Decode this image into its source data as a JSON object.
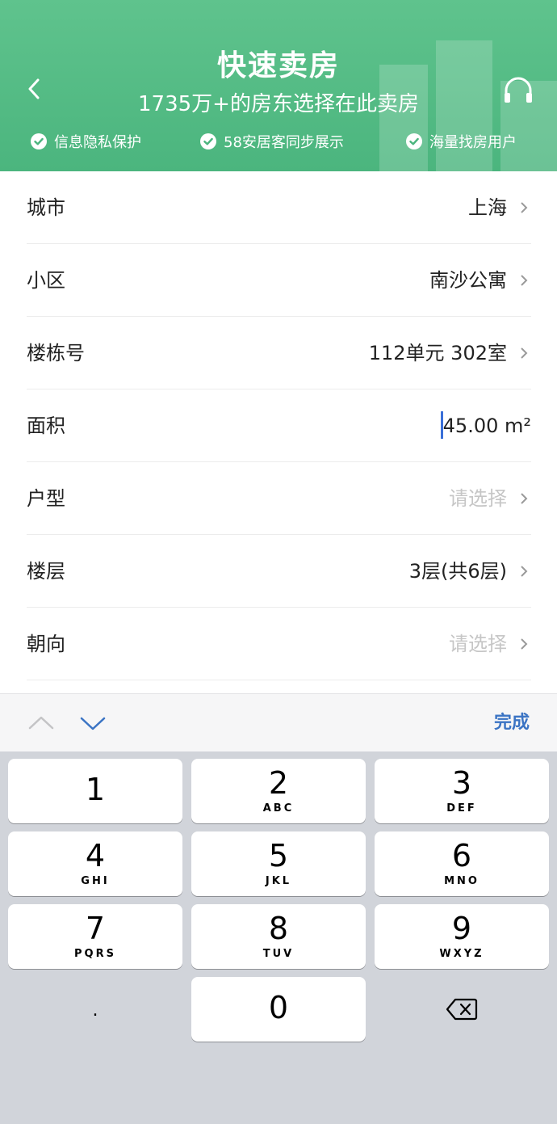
{
  "header": {
    "back_icon": "chevron-left-icon",
    "title": "快速卖房",
    "subtitle": "1735万+的房东选择在此卖房",
    "service_icon": "headset-icon",
    "features": [
      {
        "icon": "check-circle-icon",
        "label": "信息隐私保护"
      },
      {
        "icon": "check-circle-icon",
        "label": "58安居客同步展示"
      },
      {
        "icon": "check-circle-icon",
        "label": "海量找房用户"
      }
    ],
    "colors": {
      "header_bg": "#4bb57e",
      "accent": "#3b74c4"
    }
  },
  "form": {
    "rows": [
      {
        "label": "城市",
        "value": "上海",
        "placeholder": false
      },
      {
        "label": "小区",
        "value": "南沙公寓",
        "placeholder": false
      },
      {
        "label": "楼栋号",
        "value": "112单元 302室",
        "placeholder": false
      },
      {
        "label": "面积",
        "value": "45.00 m²",
        "placeholder": false
      },
      {
        "label": "户型",
        "value": "请选择",
        "placeholder": true
      },
      {
        "label": "楼层",
        "value": "3层(共6层)",
        "placeholder": false
      },
      {
        "label": "朝向",
        "value": "请选择",
        "placeholder": true
      }
    ]
  },
  "accessory_bar": {
    "prev_icon": "chevron-up-icon",
    "next_icon": "chevron-down-icon",
    "done_label": "完成"
  },
  "keypad": {
    "keys": [
      {
        "digit": "1",
        "letters": ""
      },
      {
        "digit": "2",
        "letters": "ABC"
      },
      {
        "digit": "3",
        "letters": "DEF"
      },
      {
        "digit": "4",
        "letters": "GHI"
      },
      {
        "digit": "5",
        "letters": "JKL"
      },
      {
        "digit": "6",
        "letters": "MNO"
      },
      {
        "digit": "7",
        "letters": "PQRS"
      },
      {
        "digit": "8",
        "letters": "TUV"
      },
      {
        "digit": "9",
        "letters": "WXYZ"
      },
      {
        "digit": ".",
        "letters": ""
      },
      {
        "digit": "0",
        "letters": ""
      },
      {
        "digit": "",
        "letters": "",
        "icon": "backspace-icon"
      }
    ]
  }
}
